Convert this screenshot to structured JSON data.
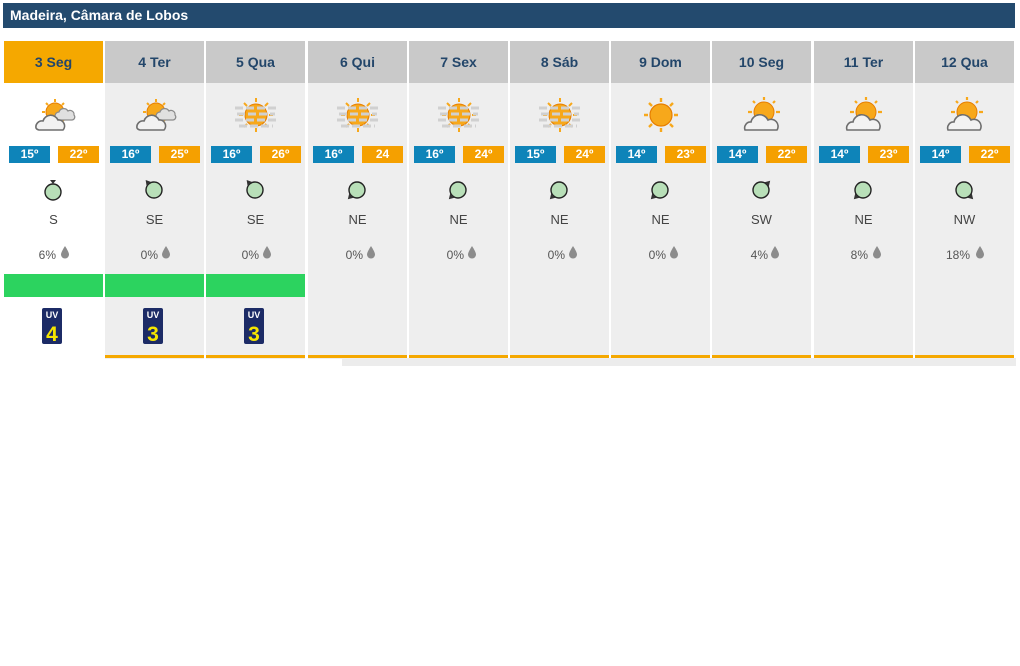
{
  "header": {
    "location": "Madeira, Câmara de Lobos"
  },
  "colors": {
    "header_bg": "#234a6e",
    "today_bg": "#f5a800",
    "min_temp": "#0e84b9",
    "max_temp": "#f5a000",
    "green_bar": "#2cd35f"
  },
  "days": [
    {
      "label": "3 Seg",
      "icon": "sun-cloud-partly-cloudy-icon",
      "tmin": "15º",
      "tmax": "22º",
      "wind_icon": "wind-arrow-icon",
      "dir": "S",
      "rain": "6%",
      "uv": "4",
      "today": true
    },
    {
      "label": "4 Ter",
      "icon": "sun-cloud-partly-cloudy-icon",
      "tmin": "16º",
      "tmax": "25º",
      "wind_icon": "wind-arrow-icon",
      "dir": "SE",
      "rain": "0%",
      "uv": "3"
    },
    {
      "label": "5 Qua",
      "icon": "hazy-sun-icon",
      "tmin": "16º",
      "tmax": "26º",
      "wind_icon": "wind-arrow-icon",
      "dir": "SE",
      "rain": "0%",
      "uv": "3"
    },
    {
      "label": "6 Qui",
      "icon": "hazy-sun-icon",
      "tmin": "16º",
      "tmax": "24",
      "wind_icon": "wind-arrow-icon",
      "dir": "NE",
      "rain": "0%"
    },
    {
      "label": "7 Sex",
      "icon": "hazy-sun-icon",
      "tmin": "16º",
      "tmax": "24º",
      "wind_icon": "wind-arrow-icon",
      "dir": "NE",
      "rain": "0%"
    },
    {
      "label": "8 Sáb",
      "icon": "hazy-sun-icon",
      "tmin": "15º",
      "tmax": "24º",
      "wind_icon": "wind-arrow-icon",
      "dir": "NE",
      "rain": "0%"
    },
    {
      "label": "9 Dom",
      "icon": "sun-icon",
      "tmin": "14º",
      "tmax": "23º",
      "wind_icon": "wind-arrow-icon",
      "dir": "NE",
      "rain": "0%"
    },
    {
      "label": "10 Seg",
      "icon": "sun-behind-cloud-icon",
      "tmin": "14º",
      "tmax": "22º",
      "wind_icon": "wind-arrow-icon",
      "dir": "SW",
      "rain": "4%"
    },
    {
      "label": "11 Ter",
      "icon": "sun-behind-cloud-icon",
      "tmin": "14º",
      "tmax": "23º",
      "wind_icon": "wind-arrow-icon",
      "dir": "NE",
      "rain": "8%"
    },
    {
      "label": "12 Qua",
      "icon": "sun-behind-cloud-icon",
      "tmin": "14º",
      "tmax": "22º",
      "wind_icon": "wind-arrow-icon",
      "dir": "NW",
      "rain": "18%"
    }
  ]
}
